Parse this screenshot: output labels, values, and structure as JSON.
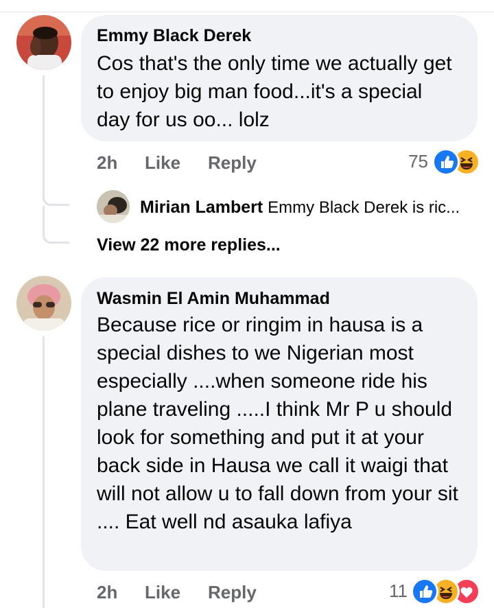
{
  "comments": [
    {
      "author": "Emmy Black Derek",
      "text": "Cos that's the only time we actually get to enjoy big man food...it's a special day for us oo... lolz",
      "time": "2h",
      "like_label": "Like",
      "reply_label": "Reply",
      "reaction_count": "75",
      "reactions": [
        "like-icon",
        "haha-icon"
      ]
    },
    {
      "author": "Wasmin El Amin Muhammad",
      "text": "Because rice or ringim in hausa is a special dishes to we Nigerian most especially ....when someone ride his plane traveling .....I think Mr P u should look for something and put it at your back side in Hausa we call it waigi that will not allow u to fall down from your sit .... Eat well nd asauka lafiya",
      "time": "2h",
      "like_label": "Like",
      "reply_label": "Reply",
      "reaction_count": "11",
      "reactions": [
        "like-icon",
        "haha-icon",
        "love-icon"
      ]
    }
  ],
  "reply_preview": {
    "author": "Mirian Lambert",
    "text": "Emmy Black Derek is ric..."
  },
  "view_more_label": "View 22 more replies...",
  "colors": {
    "bubble": "#f0f2f5",
    "meta": "#65676b",
    "like_blue": "#1877f2",
    "haha_yellow": "#f7b125",
    "love_red": "#f33e58"
  }
}
